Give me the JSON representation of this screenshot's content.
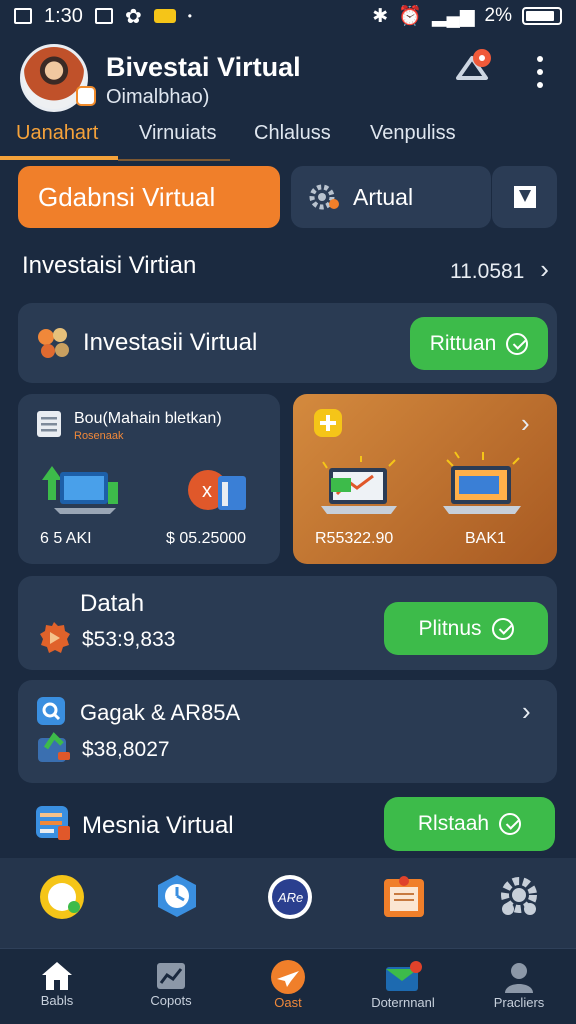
{
  "status_bar": {
    "time": "1:30",
    "battery": "2%"
  },
  "header": {
    "title": "Bivestai Virtual",
    "subtitle": "Oimalbhao)"
  },
  "tabs": [
    {
      "label": "Uanahart",
      "active": true
    },
    {
      "label": "Virnuiats",
      "active": false
    },
    {
      "label": "Chlaluss",
      "active": false
    },
    {
      "label": "Venpuliss",
      "active": false
    }
  ],
  "actions": {
    "primary_label": "Gdabnsi Virtual",
    "secondary_label": "Artual"
  },
  "section": {
    "title": "Investaisi Virtian",
    "count": "11.0581"
  },
  "card_invest": {
    "title": "Investasii Virtual",
    "button": "Rittuan"
  },
  "card_left": {
    "title": "Bou(Mahain bletkan)",
    "subtitle": "Rosenaak",
    "value_a": "6 5 AKI",
    "value_b": "$ 05.25000"
  },
  "card_right": {
    "value_a": "R55322.90",
    "value_b": "BAK1"
  },
  "card_data": {
    "title": "Datah",
    "value": "$53:9,833",
    "button": "Plitnus"
  },
  "card_gagak": {
    "title": "Gagak & AR85A",
    "value": "$38,8027"
  },
  "card_mesnia": {
    "title": "Mesnia Virtual",
    "button": "Rlstaah"
  },
  "bottom_nav": [
    {
      "label": "Babls",
      "icon": "home-icon",
      "active": false
    },
    {
      "label": "Copots",
      "icon": "chart-icon",
      "active": false
    },
    {
      "label": "Oast",
      "icon": "plane-icon",
      "active": true
    },
    {
      "label": "Doternnanl",
      "icon": "mail-icon",
      "active": false
    },
    {
      "label": "Pracliers",
      "icon": "user-icon",
      "active": false
    }
  ],
  "colors": {
    "accent": "#f07f2a",
    "success": "#3dbb4a",
    "bg": "#1b2a40",
    "card": "#2a3b53"
  }
}
